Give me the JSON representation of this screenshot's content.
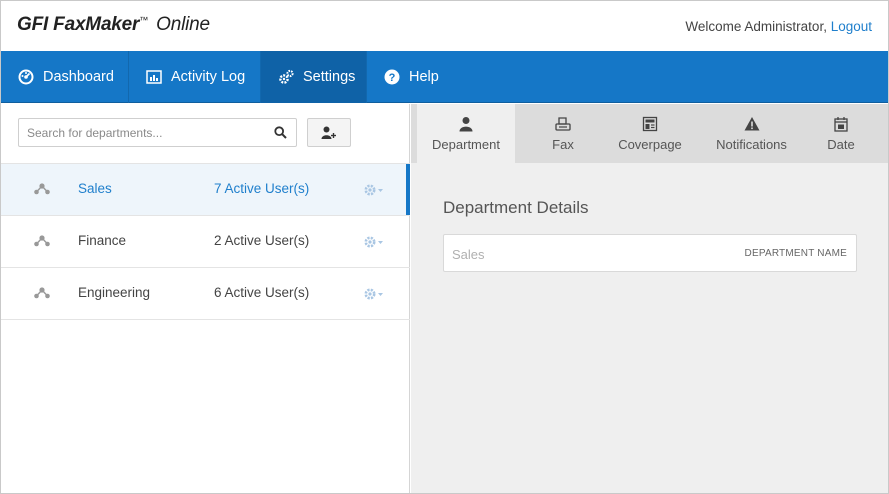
{
  "header": {
    "logo_gfi": "GFI",
    "logo_product": "FaxMaker",
    "logo_tm": "™",
    "logo_suffix": "Online",
    "welcome": "Welcome Administrator, ",
    "logout": "Logout"
  },
  "nav": {
    "items": [
      {
        "label": "Dashboard",
        "icon": "dashboard-icon"
      },
      {
        "label": "Activity Log",
        "icon": "activity-log-icon"
      },
      {
        "label": "Settings",
        "icon": "gears-icon"
      },
      {
        "label": "Help",
        "icon": "help-icon"
      }
    ],
    "active": "Settings"
  },
  "search": {
    "placeholder": "Search for departments...",
    "value": ""
  },
  "departments": [
    {
      "name": "Sales",
      "users": "7 Active User(s)",
      "selected": true
    },
    {
      "name": "Finance",
      "users": "2 Active User(s)",
      "selected": false
    },
    {
      "name": "Engineering",
      "users": "6 Active User(s)",
      "selected": false
    }
  ],
  "tabs": [
    {
      "label": "Department",
      "icon": "person-icon"
    },
    {
      "label": "Fax",
      "icon": "fax-icon"
    },
    {
      "label": "Coverpage",
      "icon": "coverpage-icon"
    },
    {
      "label": "Notifications",
      "icon": "warning-icon"
    },
    {
      "label": "Date",
      "icon": "calendar-icon"
    }
  ],
  "details": {
    "title": "Department Details",
    "field_value": "Sales",
    "field_label": "DEPARTMENT NAME"
  },
  "colors": {
    "nav_bg": "#1577c7",
    "accent": "#1f7fcc"
  }
}
